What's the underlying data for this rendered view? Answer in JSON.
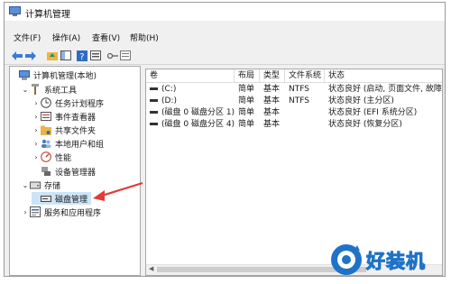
{
  "window": {
    "title": "计算机管理"
  },
  "menu": [
    "文件(F)",
    "操作(A)",
    "查看(V)",
    "帮助(H)"
  ],
  "toolbar": {
    "icons": [
      "back-icon",
      "forward-icon",
      "up-folder-icon",
      "show-tree-icon",
      "help-icon",
      "properties-icon",
      "key-icon",
      "list-view-icon"
    ]
  },
  "tree": [
    {
      "label": "计算机管理(本地)",
      "icon": "computer-icon",
      "level": 0,
      "expand": ""
    },
    {
      "label": "系统工具",
      "icon": "tools-icon",
      "level": 1,
      "expand": "v"
    },
    {
      "label": "任务计划程序",
      "icon": "clock-icon",
      "level": 2,
      "expand": ">"
    },
    {
      "label": "事件查看器",
      "icon": "event-viewer-icon",
      "level": 2,
      "expand": ">"
    },
    {
      "label": "共享文件夹",
      "icon": "shared-folder-icon",
      "level": 2,
      "expand": ">"
    },
    {
      "label": "本地用户和组",
      "icon": "users-icon",
      "level": 2,
      "expand": ">"
    },
    {
      "label": "性能",
      "icon": "performance-icon",
      "level": 2,
      "expand": ">"
    },
    {
      "label": "设备管理器",
      "icon": "device-manager-icon",
      "level": 2,
      "expand": ""
    },
    {
      "label": "存储",
      "icon": "storage-icon",
      "level": 1,
      "expand": "v"
    },
    {
      "label": "磁盘管理",
      "icon": "disk-icon",
      "level": 2,
      "expand": "",
      "selected": true
    },
    {
      "label": "服务和应用程序",
      "icon": "services-icon",
      "level": 1,
      "expand": ">"
    }
  ],
  "columns": [
    "卷",
    "布局",
    "类型",
    "文件系统",
    "状态"
  ],
  "rows": [
    {
      "vol": "(C:)",
      "layout": "简单",
      "type": "基本",
      "fs": "NTFS",
      "status": "状态良好 (启动, 页面文件, 故障转"
    },
    {
      "vol": "(D:)",
      "layout": "简单",
      "type": "基本",
      "fs": "NTFS",
      "status": "状态良好 (主分区)"
    },
    {
      "vol": "(磁盘 0 磁盘分区 1)",
      "layout": "简单",
      "type": "基本",
      "fs": "",
      "status": "状态良好 (EFI 系统分区)"
    },
    {
      "vol": "(磁盘 0 磁盘分区 4)",
      "layout": "简单",
      "type": "基本",
      "fs": "",
      "status": "状态良好 (恢复分区)"
    }
  ],
  "watermark": "好装机",
  "colors": {
    "selection": "#cce4f7",
    "arrow": "#e53935",
    "watermark": "#1e73c8"
  }
}
